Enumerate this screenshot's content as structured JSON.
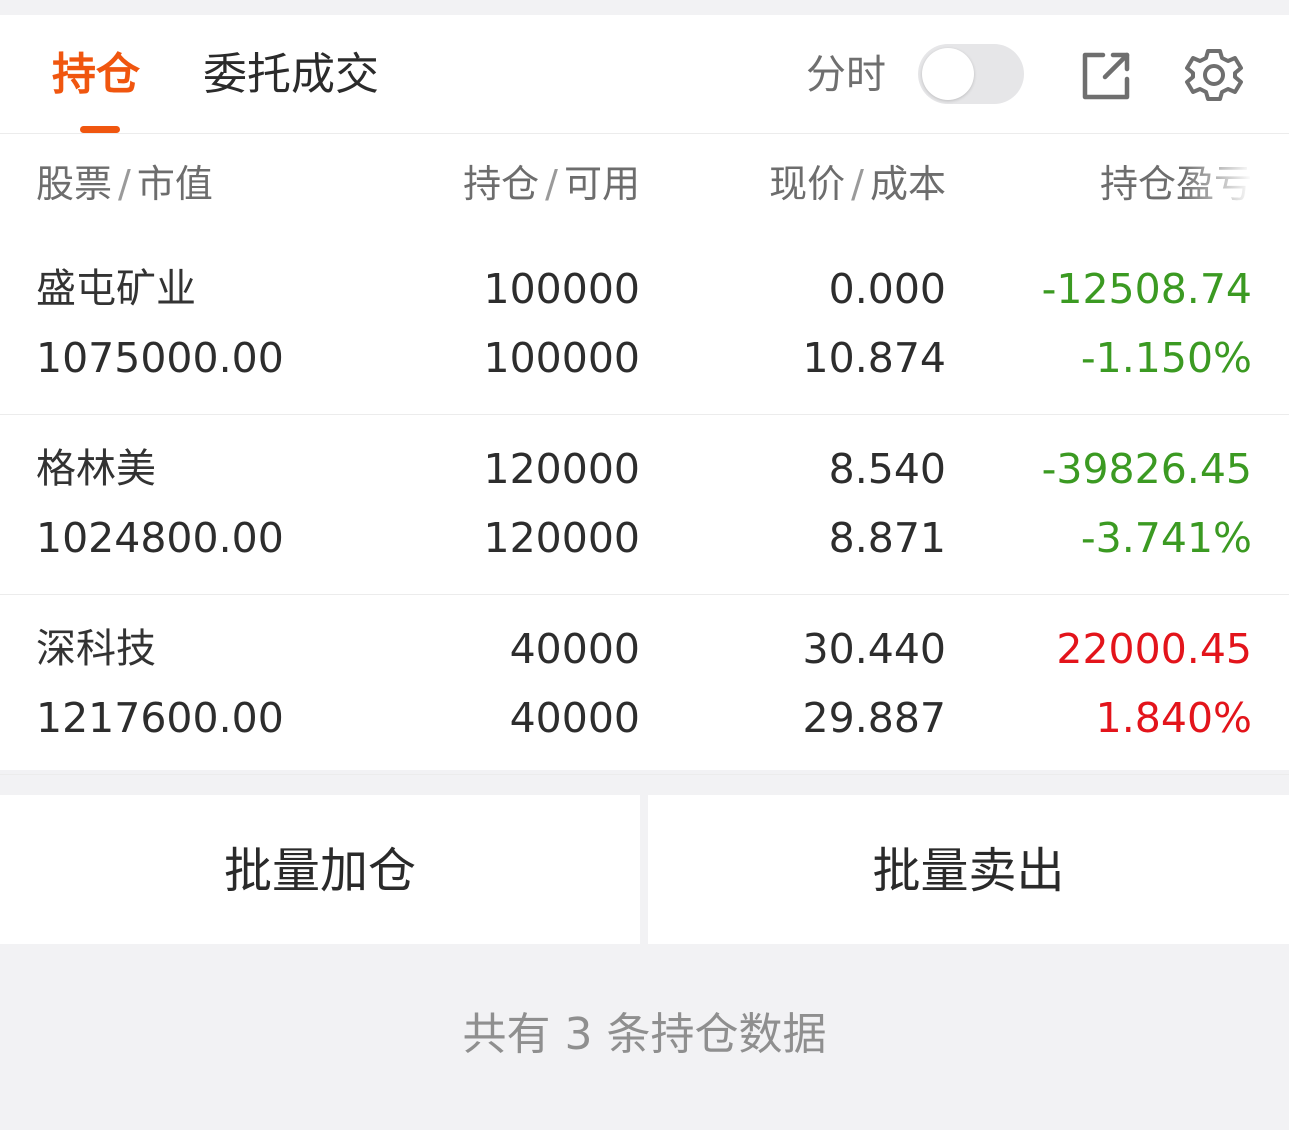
{
  "tabs": {
    "holdings": "持仓",
    "orders": "委托成交"
  },
  "timeshare": {
    "label": "分时",
    "enabled": false
  },
  "icons": {
    "export": "share-export-icon",
    "settings": "gear-icon"
  },
  "colors": {
    "accent": "#f0560f",
    "loss": "#3b9a22",
    "profit": "#e3141b"
  },
  "columns": {
    "col1": {
      "a": "股票",
      "sep": "/",
      "b": "市值"
    },
    "col2": {
      "a": "持仓",
      "sep": "/",
      "b": "可用"
    },
    "col3": {
      "a": "现价",
      "sep": "/",
      "b": "成本"
    },
    "col4": {
      "a": "持仓盈亏"
    }
  },
  "positions": [
    {
      "name": "盛屯矿业",
      "market_value": "1075000.00",
      "holding": "100000",
      "available": "100000",
      "price": "0.000",
      "cost": "10.874",
      "pnl": "-12508.74",
      "pnl_pct": "-1.150%"
    },
    {
      "name": "格林美",
      "market_value": "1024800.00",
      "holding": "120000",
      "available": "120000",
      "price": "8.540",
      "cost": "8.871",
      "pnl": "-39826.45",
      "pnl_pct": "-3.741%"
    },
    {
      "name": "深科技",
      "market_value": "1217600.00",
      "holding": "40000",
      "available": "40000",
      "price": "30.440",
      "cost": "29.887",
      "pnl": "22000.45",
      "pnl_pct": "1.840%"
    }
  ],
  "actions": {
    "batch_add": "批量加仓",
    "batch_sell": "批量卖出"
  },
  "footer": "共有 3 条持仓数据"
}
